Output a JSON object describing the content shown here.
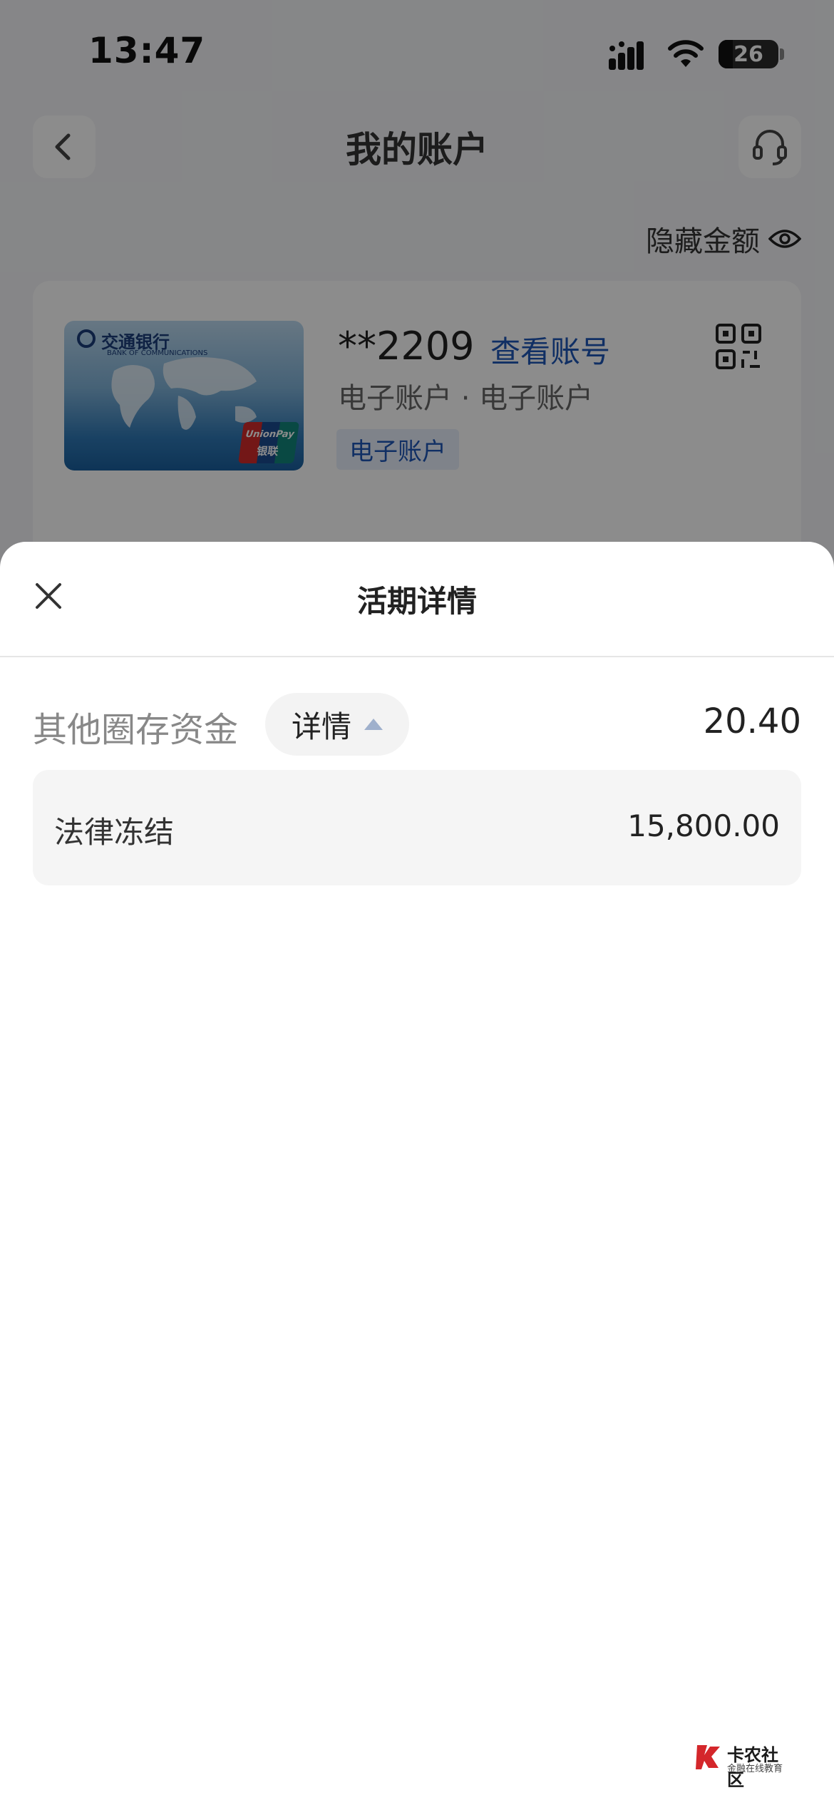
{
  "status_bar": {
    "time": "13:47",
    "battery": "26"
  },
  "nav": {
    "title": "我的账户"
  },
  "hide_amount_label": "隐藏金额",
  "card": {
    "bank_name": "交通银行",
    "bank_english": "BANK OF COMMUNICATIONS",
    "brand_top": "UnionPay",
    "brand_bottom": "银联",
    "account_masked": "**2209",
    "view_account_label": "查看账号",
    "account_type": "电子账户 · 电子账户",
    "tag": "电子账户"
  },
  "sheet": {
    "title": "活期详情",
    "main_row": {
      "label": "其他圈存资金",
      "detail_button": "详情",
      "value": "20.40"
    },
    "sub_row": {
      "label": "法律冻结",
      "value": "15,800.00"
    }
  },
  "watermark": {
    "title": "卡农社区",
    "subtitle": "金融在线教育"
  }
}
